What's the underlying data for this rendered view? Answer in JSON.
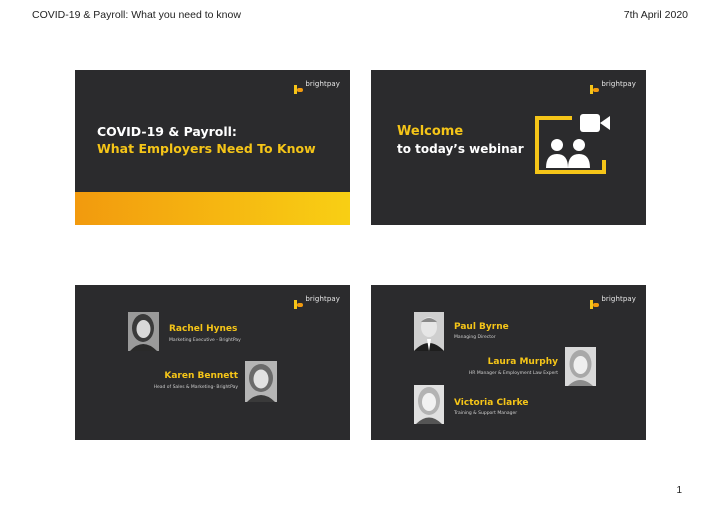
{
  "header": {
    "title": "COVID-19 & Payroll: What you need to know",
    "date": "7th April 2020"
  },
  "page_number": "1",
  "brand": {
    "logo_text": "brightpay",
    "accent": "#f5c518",
    "slide_bg": "#2b2b2d"
  },
  "slides": {
    "title_slide": {
      "line1": "COVID-19 & Payroll:",
      "line2": "What Employers Need To Know"
    },
    "welcome_slide": {
      "line1": "Welcome",
      "line2": "to today’s webinar",
      "icon": "webcam-meeting-icon"
    },
    "presenters_slide": {
      "people": [
        {
          "name": "Rachel Hynes",
          "role": "Marketing Executive - BrightPay"
        },
        {
          "name": "Karen Bennett",
          "role": "Head of Sales & Marketing- BrightPay"
        }
      ]
    },
    "guests_slide": {
      "people": [
        {
          "name": "Paul Byrne",
          "role": "Managing Director"
        },
        {
          "name": "Laura Murphy",
          "role": "HR Manager & Employment Law Expert"
        },
        {
          "name": "Victoria Clarke",
          "role": "Training & Support Manager"
        }
      ]
    }
  }
}
